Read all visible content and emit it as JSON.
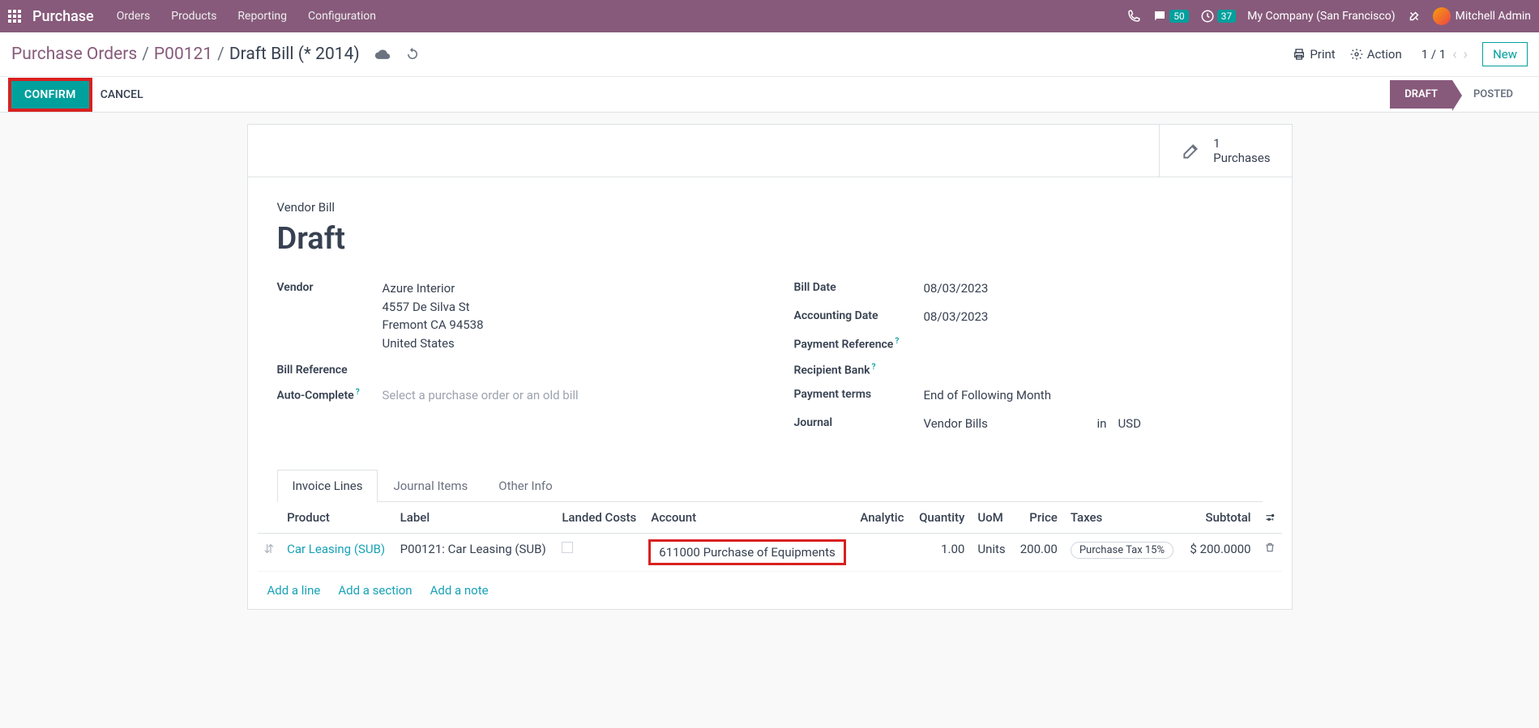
{
  "topbar": {
    "brand": "Purchase",
    "menu": [
      "Orders",
      "Products",
      "Reporting",
      "Configuration"
    ],
    "msg_count": "50",
    "activity_count": "37",
    "company": "My Company (San Francisco)",
    "user": "Mitchell Admin"
  },
  "breadcrumbs": {
    "items": [
      "Purchase Orders",
      "P00121"
    ],
    "current": "Draft Bill (* 2014)"
  },
  "actions": {
    "print": "Print",
    "action": "Action",
    "pager": "1 / 1",
    "new": "New"
  },
  "statusbar": {
    "confirm": "CONFIRM",
    "cancel": "CANCEL",
    "draft": "DRAFT",
    "posted": "POSTED"
  },
  "smart": {
    "purchases_count": "1",
    "purchases_label": "Purchases"
  },
  "title": {
    "label": "Vendor Bill",
    "value": "Draft"
  },
  "left": {
    "vendor_label": "Vendor",
    "vendor_name": "Azure Interior",
    "vendor_addr1": "4557 De Silva St",
    "vendor_addr2": "Fremont CA 94538",
    "vendor_addr3": "United States",
    "billref_label": "Bill Reference",
    "autocomplete_label": "Auto-Complete",
    "autocomplete_placeholder": "Select a purchase order or an old bill"
  },
  "right": {
    "billdate_label": "Bill Date",
    "billdate_value": "08/03/2023",
    "acctdate_label": "Accounting Date",
    "acctdate_value": "08/03/2023",
    "payref_label": "Payment Reference",
    "recbank_label": "Recipient Bank",
    "payterms_label": "Payment terms",
    "payterms_value": "End of Following Month",
    "journal_label": "Journal",
    "journal_value": "Vendor Bills",
    "journal_in": "in",
    "journal_currency": "USD"
  },
  "tabs": [
    "Invoice Lines",
    "Journal Items",
    "Other Info"
  ],
  "table": {
    "headers": {
      "product": "Product",
      "label": "Label",
      "landed": "Landed Costs",
      "account": "Account",
      "analytic": "Analytic",
      "qty": "Quantity",
      "uom": "UoM",
      "price": "Price",
      "taxes": "Taxes",
      "subtotal": "Subtotal"
    },
    "row": {
      "product": "Car Leasing (SUB)",
      "label": "P00121: Car Leasing (SUB)",
      "account": "611000 Purchase of Equipments",
      "qty": "1.00",
      "uom": "Units",
      "price": "200.00",
      "tax": "Purchase Tax 15%",
      "subtotal": "$ 200.0000"
    }
  },
  "addlinks": {
    "line": "Add a line",
    "section": "Add a section",
    "note": "Add a note"
  }
}
